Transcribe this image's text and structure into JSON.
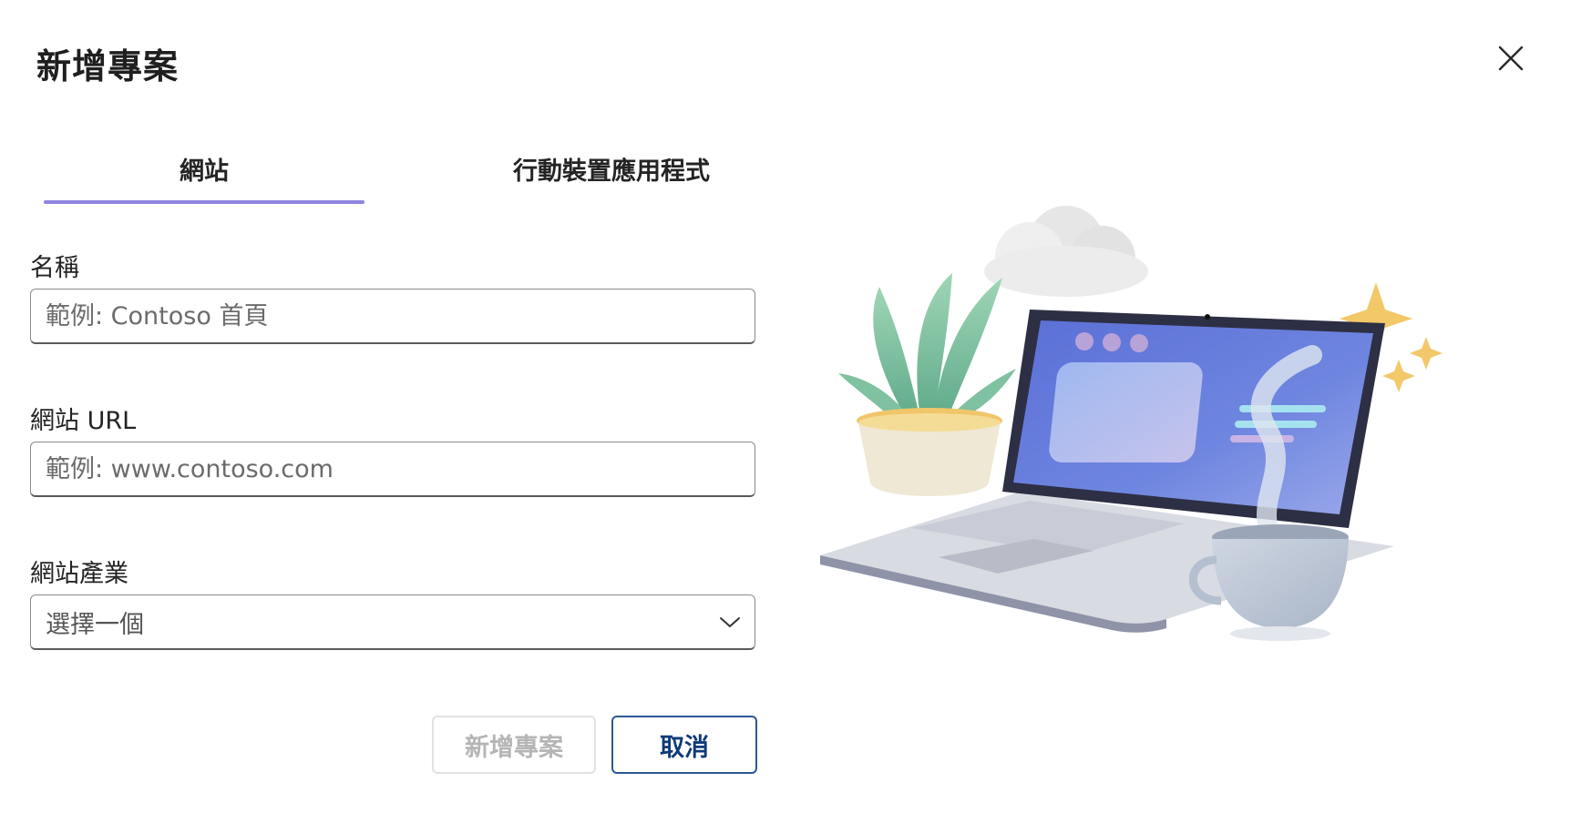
{
  "dialog": {
    "title": "新增專案",
    "close_icon": "close-icon"
  },
  "tabs": [
    {
      "label": "網站",
      "selected": true
    },
    {
      "label": "行動裝置應用程式",
      "selected": false
    }
  ],
  "form": {
    "name": {
      "label": "名稱",
      "placeholder": "範例: Contoso 首頁"
    },
    "url": {
      "label": "網站 URL",
      "placeholder": "範例: www.contoso.com"
    },
    "industry": {
      "label": "網站產業",
      "selected_value": "選擇一個",
      "icon": "chevron-down-icon"
    }
  },
  "actions": {
    "add_label": "新增專案",
    "add_disabled": true,
    "cancel_label": "取消"
  },
  "colors": {
    "tab_underline": "#8e84e0",
    "cancel_border": "#2b5797"
  }
}
